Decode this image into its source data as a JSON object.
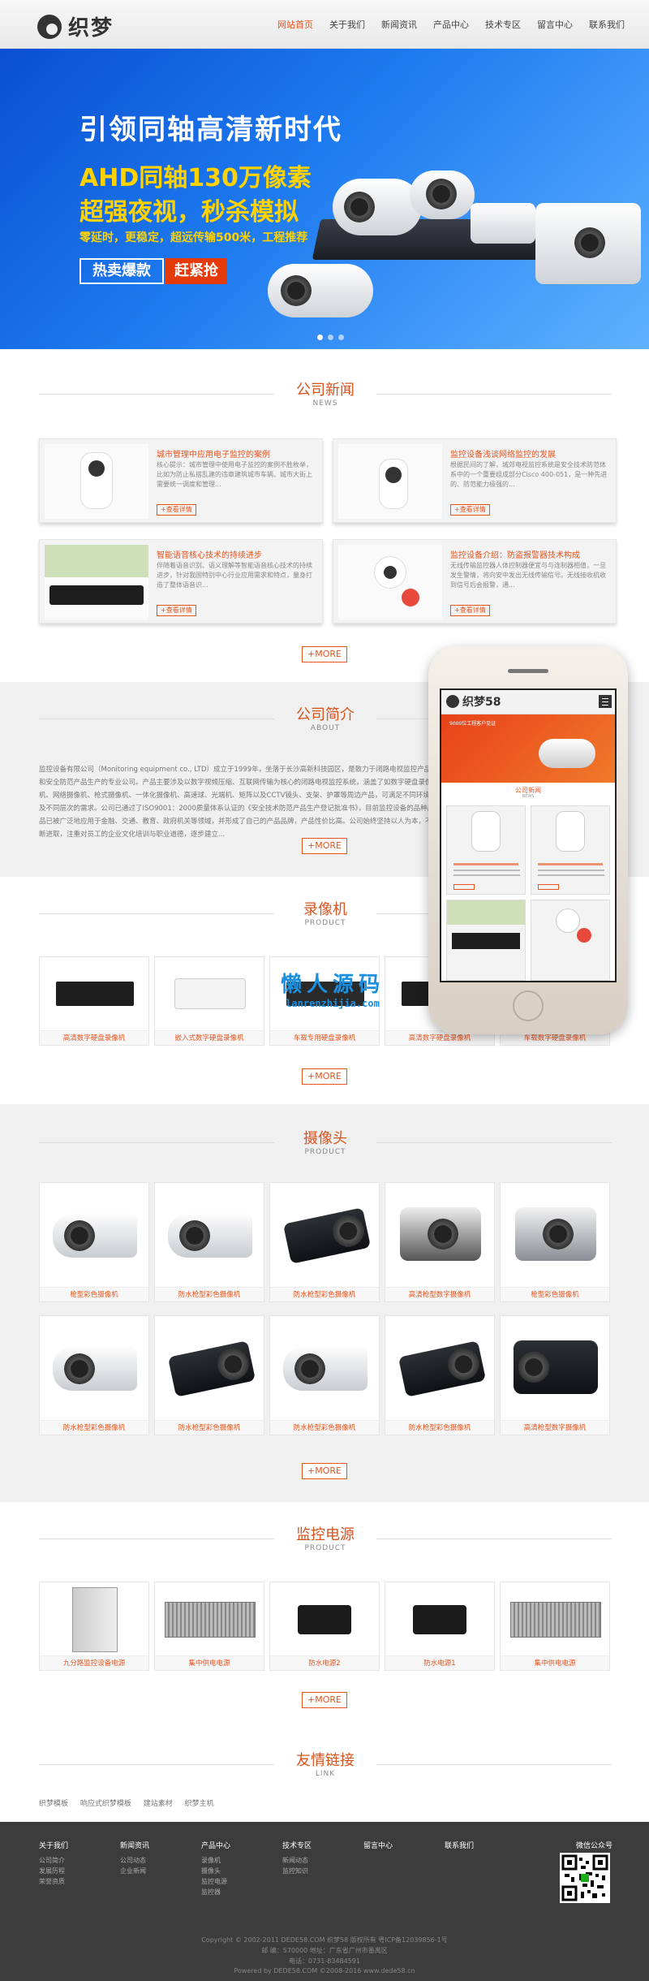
{
  "header": {
    "logo_text": "织梦",
    "nav": [
      "网站首页",
      "关于我们",
      "新闻资讯",
      "产品中心",
      "技术专区",
      "留言中心",
      "联系我们"
    ]
  },
  "banner": {
    "line1": "引领同轴高清新时代",
    "line2": "AHD同轴130万像素",
    "line3": "超强夜视，秒杀模拟",
    "line4": "零延时，更稳定，超远传输500米，工程推荐",
    "hot_label": "热卖爆款",
    "grab_label": "赶紧抢"
  },
  "news": {
    "title": "公司新闻",
    "sub": "NEWS",
    "more": "+MORE",
    "read_label": "+查看详情",
    "items": [
      {
        "title": "城市管理中应用电子监控的案例",
        "desc": "核心提示：城市管理中使用电子监控的案例不胜枚举，比如为防止私搭乱建的违章建筑城市车辆、城市大街上需要统一调度和管理..."
      },
      {
        "title": "监控设备浅谈网络监控的发展",
        "desc": "根据民间的了解，城郊电视监控系统是安全技术防范体系中的一个重要组成部分Cisco 400-051，是一种先进的、防范能力极强的..."
      },
      {
        "title": "智能语音核心技术的持续进步",
        "desc": "伴随着语音识别、语义理解等智能语音核心技术的持续进步，针对我国特别中心行业应用需求和特点，量身打造了整体语音识..."
      },
      {
        "title": "监控设备介绍：防盗报警器技术构成",
        "desc": "无线传输监控器人体控制器便宜与与连制器相值，一旦发生警情，将向安中发出无线传输信号。无线接收机收到信号后会报警，通..."
      }
    ]
  },
  "about": {
    "title": "公司简介",
    "sub": "ABOUT",
    "more": "+MORE",
    "text": "监控设备有限公司（Monitoring equipment co., LTD）成立于1999年，坐落于长沙高新科技园区，是致力于闭路电视监控产品和安全防范产品生产的专业公司。产品主要涉及以数字视频压缩、互联网传输为核心的闭路电视监控系统，涵盖了如数字硬盘录像机、网络摄像机、枪式摄像机、一体化摄像机、高速球、光端机、矩阵以及CCTV镜头、支架、护罩等周边产品，可满足不同环境及不同层次的需求。公司已通过了ISO9001：2000质量体系认证的《安全技术防范产品生产登记批准书》，目前监控设备的品种产品已被广泛地应用于金融、交通、教育、政府机关等领域，并形成了自己的产品品牌，产品性价比高。公司始终坚持以人为本，不断进取，注重对员工的企业文化培训与职业道德，逐步建立..."
  },
  "dvr": {
    "title": "录像机",
    "sub": "PRODUCT",
    "more": "+MORE",
    "items": [
      "高清数字硬盘录像机",
      "嵌入式数字硬盘录像机",
      "车载专用硬盘录像机",
      "高清数字硬盘录像机",
      "车载数字硬盘录像机"
    ]
  },
  "camera": {
    "title": "摄像头",
    "sub": "PRODUCT",
    "more": "+MORE",
    "items": [
      "枪型彩色摄像机",
      "防水枪型彩色摄像机",
      "防水枪型彩色摄像机",
      "高清枪型数字摄像机",
      "枪型彩色摄像机",
      "防水枪型彩色摄像机",
      "防水枪型彩色摄像机",
      "防水枪型彩色摄像机",
      "防水枪型彩色摄像机",
      "高清枪型数字摄像机"
    ]
  },
  "power": {
    "title": "监控电源",
    "sub": "PRODUCT",
    "more": "+MORE",
    "items": [
      "九分路监控设备电源",
      "集中供电电源",
      "防水电源2",
      "防水电源1",
      "集中供电电源"
    ]
  },
  "links": {
    "title": "友情链接",
    "sub": "LINK",
    "items": [
      "织梦模板",
      "响应式织梦模板",
      "建站素材",
      "织梦主机"
    ]
  },
  "footer": {
    "cols": [
      {
        "h": "关于我们",
        "items": [
          "公司简介",
          "发展历程",
          "荣誉资质"
        ]
      },
      {
        "h": "新闻资讯",
        "items": [
          "公司动态",
          "企业新闻"
        ]
      },
      {
        "h": "产品中心",
        "items": [
          "录像机",
          "摄像头",
          "监控电源",
          "监控器"
        ]
      },
      {
        "h": "技术专区",
        "items": [
          "新闻动态",
          "监控知识"
        ]
      },
      {
        "h": "留言中心",
        "items": []
      },
      {
        "h": "联系我们",
        "items": []
      }
    ],
    "qr_label": "微信公众号",
    "copy1": "Copyright © 2002-2011 DEDE58.COM 织梦58 版权所有 粤ICP备12039856-1号",
    "copy2": "邮 编：570000 地址：广东省广州市番禺区",
    "copy3": "电话：0731-83484591",
    "copy4": "Powered by DEDE58.COM ©2008-2016 www.dede58.cn"
  },
  "phone": {
    "logo": "织梦58",
    "news_title": "公司新闻",
    "news_sub": "NEWS",
    "banner_caption": "9000位工程客户见证"
  },
  "watermark": {
    "title": "懒人源码",
    "url": "lanrenzhijia.com"
  }
}
